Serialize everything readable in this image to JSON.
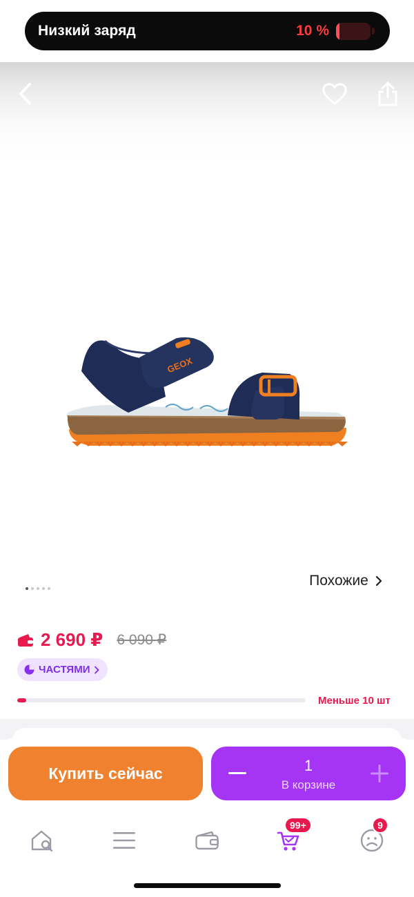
{
  "status": {
    "title": "Низкий заряд",
    "battery_percent": "10 %",
    "battery_level": 0.1
  },
  "header": {
    "back_icon": "chevron-left-icon",
    "favorite_icon": "heart-icon",
    "share_icon": "share-icon"
  },
  "gallery": {
    "product": "sandal",
    "logo_text": "GEOX",
    "images_count": 5,
    "active_index": 0,
    "similar_label": "Похожие"
  },
  "price": {
    "wallet_icon": "wallet-icon",
    "current": "2 690 ₽",
    "old": "6 090 ₽",
    "installment_label": "ЧАСТЯМИ",
    "stock_label": "Меньше 10 шт",
    "stock_level": 0.03
  },
  "actions": {
    "buy_now": "Купить сейчас",
    "quantity": "1",
    "in_cart": "В корзине"
  },
  "tabbar": {
    "items": [
      {
        "name": "home-search",
        "icon": "home-search-icon"
      },
      {
        "name": "catalog",
        "icon": "menu-icon"
      },
      {
        "name": "wallet",
        "icon": "wallet-icon"
      },
      {
        "name": "cart",
        "icon": "cart-icon",
        "badge": "99+"
      },
      {
        "name": "profile",
        "icon": "profile-icon",
        "badge": "9"
      }
    ]
  },
  "colors": {
    "accent_red": "#e8194f",
    "accent_orange": "#f0822f",
    "accent_purple": "#a534f5"
  }
}
